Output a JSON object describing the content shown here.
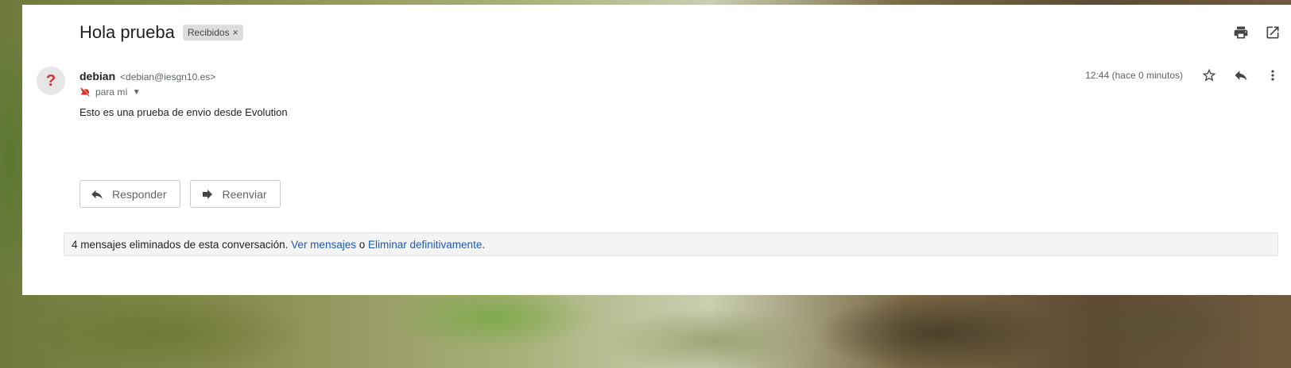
{
  "email": {
    "subject": "Hola prueba",
    "label": "Recibidos",
    "label_remove": "×",
    "sender_name": "debian",
    "sender_email": "<debian@iesgn10.es>",
    "to_text": "para mí",
    "time": "12:44 (hace 0 minutos)",
    "body": "Esto es una prueba de envio desde Evolution"
  },
  "actions": {
    "reply": "Responder",
    "forward": "Reenviar"
  },
  "deleted": {
    "text": "4 mensajes eliminados de esta conversación.",
    "view_link": "Ver mensajes",
    "or": "o",
    "delete_link": "Eliminar definitivamente",
    "period": "."
  },
  "icons": {
    "avatar": "unknown-sender-icon",
    "print": "print-icon",
    "open_new": "open-in-new-window-icon",
    "star": "star-icon",
    "reply": "reply-icon",
    "more": "more-vertical-icon",
    "not_important": "label-important-off-icon",
    "caret": "chevron-down-icon",
    "forward": "forward-icon"
  },
  "colors": {
    "link": "#1a5bb5",
    "avatar_mark": "#d32f2f"
  }
}
